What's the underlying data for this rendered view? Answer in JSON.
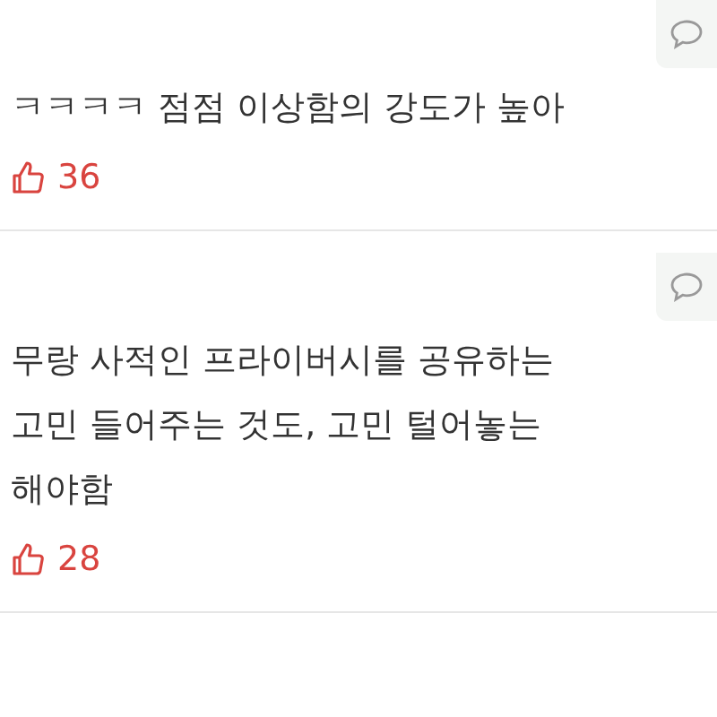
{
  "comments": [
    {
      "lines": [
        "ㅋㅋㅋㅋ 점점 이상함의 강도가 높아"
      ],
      "likes": "36"
    },
    {
      "lines": [
        "무랑 사적인 프라이버시를 공유하는",
        "고민 들어주는 것도, 고민 털어놓는",
        "해야함"
      ],
      "likes": "28"
    }
  ]
}
